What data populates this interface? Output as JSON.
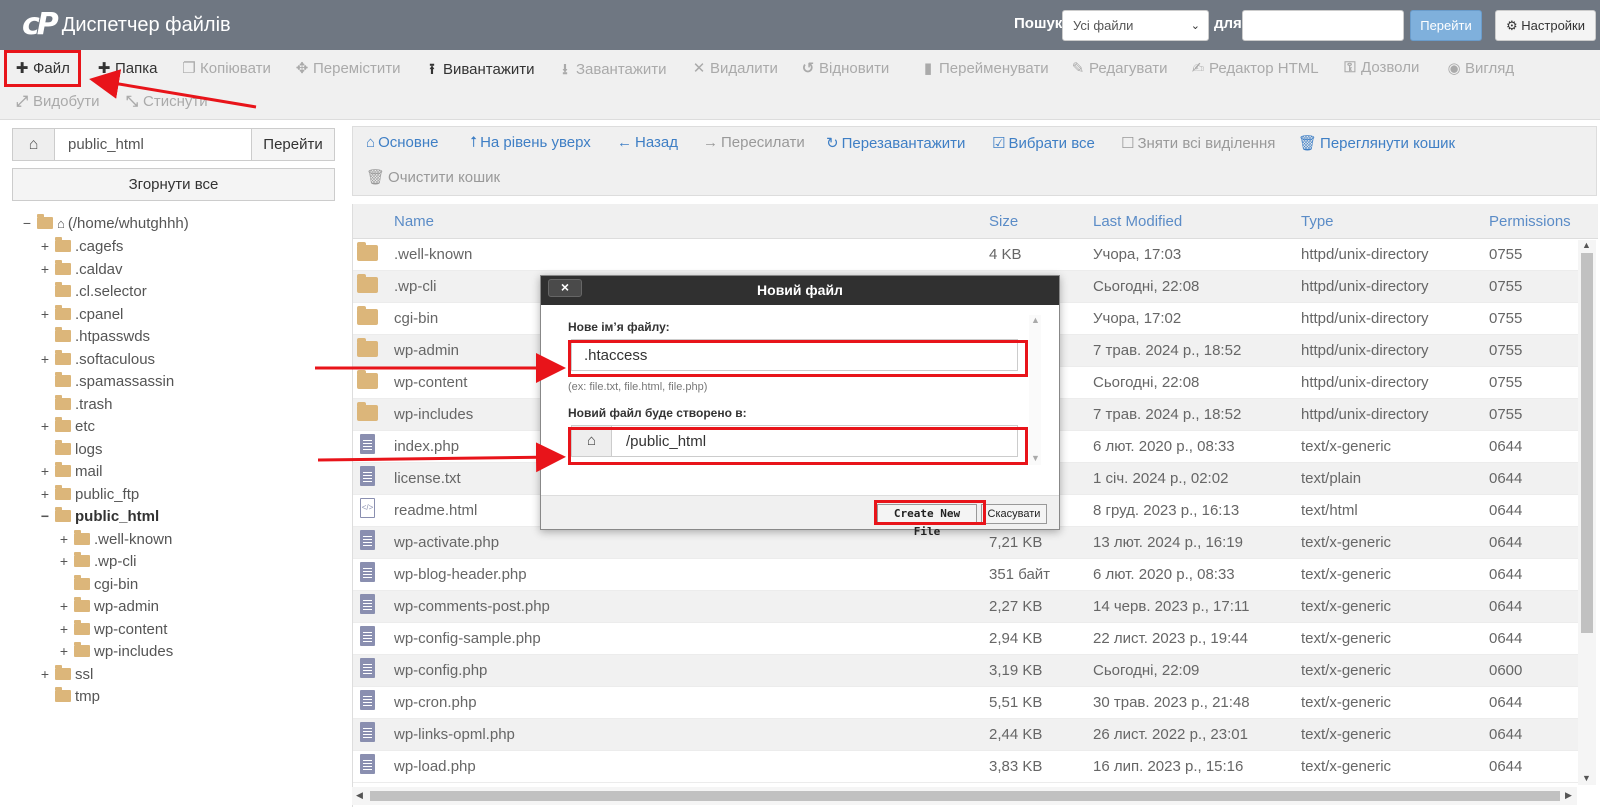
{
  "header": {
    "logo_mark": "cP",
    "title": "Диспетчер файлів",
    "search_label": "Пошук",
    "search_scope": "Усі файли",
    "for_label": "для",
    "search_value": "",
    "go_label": "Перейти",
    "settings_label": "Настройки"
  },
  "toolbar": {
    "items": [
      {
        "label": "Файл",
        "icon": "plus-icon",
        "enabled": true
      },
      {
        "label": "Папка",
        "icon": "plus-icon",
        "enabled": true
      },
      {
        "label": "Копіювати",
        "icon": "copy-icon",
        "enabled": false
      },
      {
        "label": "Перемістити",
        "icon": "move-icon",
        "enabled": false
      },
      {
        "label": "Вивантажити",
        "icon": "upload-icon",
        "enabled": true
      },
      {
        "label": "Завантажити",
        "icon": "download-icon",
        "enabled": false
      },
      {
        "label": "Видалити",
        "icon": "delete-icon",
        "enabled": false
      },
      {
        "label": "Відновити",
        "icon": "restore-icon",
        "enabled": false
      },
      {
        "label": "Перейменувати",
        "icon": "file-icon",
        "enabled": false
      },
      {
        "label": "Редагувати",
        "icon": "pencil-icon",
        "enabled": false
      },
      {
        "label": "Редактор HTML",
        "icon": "edit-icon",
        "enabled": false
      },
      {
        "label": "Дозволи",
        "icon": "key-icon",
        "enabled": false
      },
      {
        "label": "Вигляд",
        "icon": "eye-icon",
        "enabled": false
      },
      {
        "label": "Видобути",
        "icon": "expand-icon",
        "enabled": false
      },
      {
        "label": "Стиснути",
        "icon": "compress-icon",
        "enabled": false
      }
    ]
  },
  "left_pane": {
    "path_value": "public_html",
    "go_label": "Перейти",
    "collapse_label": "Згорнути все",
    "tree": [
      {
        "label": "(/home/whutghhh)",
        "toggle": "−",
        "home": true
      },
      {
        "label": ".cagefs",
        "toggle": "+"
      },
      {
        "label": ".caldav",
        "toggle": "+"
      },
      {
        "label": ".cl.selector",
        "toggle": ""
      },
      {
        "label": ".cpanel",
        "toggle": "+"
      },
      {
        "label": ".htpasswds",
        "toggle": ""
      },
      {
        "label": ".softaculous",
        "toggle": "+"
      },
      {
        "label": ".spamassassin",
        "toggle": ""
      },
      {
        "label": ".trash",
        "toggle": ""
      },
      {
        "label": "etc",
        "toggle": "+"
      },
      {
        "label": "logs",
        "toggle": ""
      },
      {
        "label": "mail",
        "toggle": "+"
      },
      {
        "label": "public_ftp",
        "toggle": "+"
      },
      {
        "label": "public_html",
        "toggle": "−",
        "bold": true
      },
      {
        "label": ".well-known",
        "toggle": "+",
        "depth": 2
      },
      {
        "label": ".wp-cli",
        "toggle": "+",
        "depth": 2
      },
      {
        "label": "cgi-bin",
        "toggle": "",
        "depth": 2
      },
      {
        "label": "wp-admin",
        "toggle": "+",
        "depth": 2
      },
      {
        "label": "wp-content",
        "toggle": "+",
        "depth": 2
      },
      {
        "label": "wp-includes",
        "toggle": "+",
        "depth": 2
      },
      {
        "label": "ssl",
        "toggle": "+"
      },
      {
        "label": "tmp",
        "toggle": ""
      }
    ]
  },
  "nav": {
    "home": "Основне",
    "up": "На рівень уверх",
    "back": "Назад",
    "forward": "Пересилати",
    "reload": "Перезавантажити",
    "select_all": "Вибрати все",
    "unselect_all": "Зняти всі виділення",
    "view_trash": "Переглянути кошик",
    "empty_trash": "Очистити кошик"
  },
  "table": {
    "columns": {
      "name": "Name",
      "size": "Size",
      "modified": "Last Modified",
      "type": "Type",
      "perms": "Permissions"
    },
    "rows": [
      {
        "icon": "folder",
        "name": ".well-known",
        "size": "4 KB",
        "modified": "Учора, 17:03",
        "type": "httpd/unix-directory",
        "perms": "0755"
      },
      {
        "icon": "folder",
        "name": ".wp-cli",
        "size": "",
        "modified": "Сьогодні, 22:08",
        "type": "httpd/unix-directory",
        "perms": "0755"
      },
      {
        "icon": "folder",
        "name": "cgi-bin",
        "size": "",
        "modified": "Учора, 17:02",
        "type": "httpd/unix-directory",
        "perms": "0755"
      },
      {
        "icon": "folder",
        "name": "wp-admin",
        "size": "",
        "modified": "7 трав. 2024 р., 18:52",
        "type": "httpd/unix-directory",
        "perms": "0755"
      },
      {
        "icon": "folder",
        "name": "wp-content",
        "size": "",
        "modified": "Сьогодні, 22:08",
        "type": "httpd/unix-directory",
        "perms": "0755"
      },
      {
        "icon": "folder",
        "name": "wp-includes",
        "size": "",
        "modified": "7 трав. 2024 р., 18:52",
        "type": "httpd/unix-directory",
        "perms": "0755"
      },
      {
        "icon": "doc",
        "name": "index.php",
        "size": "",
        "modified": "6 лют. 2020 р., 08:33",
        "type": "text/x-generic",
        "perms": "0644"
      },
      {
        "icon": "doc",
        "name": "license.txt",
        "size": "",
        "modified": "1 січ. 2024 р., 02:02",
        "type": "text/plain",
        "perms": "0644"
      },
      {
        "icon": "html",
        "name": "readme.html",
        "size": "",
        "modified": "8 груд. 2023 р., 16:13",
        "type": "text/html",
        "perms": "0644"
      },
      {
        "icon": "doc",
        "name": "wp-activate.php",
        "size": "7,21 KB",
        "modified": "13 лют. 2024 р., 16:19",
        "type": "text/x-generic",
        "perms": "0644"
      },
      {
        "icon": "doc",
        "name": "wp-blog-header.php",
        "size": "351 байт",
        "modified": "6 лют. 2020 р., 08:33",
        "type": "text/x-generic",
        "perms": "0644"
      },
      {
        "icon": "doc",
        "name": "wp-comments-post.php",
        "size": "2,27 KB",
        "modified": "14 черв. 2023 р., 17:11",
        "type": "text/x-generic",
        "perms": "0644"
      },
      {
        "icon": "doc",
        "name": "wp-config-sample.php",
        "size": "2,94 KB",
        "modified": "22 лист. 2023 р., 19:44",
        "type": "text/x-generic",
        "perms": "0644"
      },
      {
        "icon": "doc",
        "name": "wp-config.php",
        "size": "3,19 KB",
        "modified": "Сьогодні, 22:09",
        "type": "text/x-generic",
        "perms": "0600"
      },
      {
        "icon": "doc",
        "name": "wp-cron.php",
        "size": "5,51 KB",
        "modified": "30 трав. 2023 р., 21:48",
        "type": "text/x-generic",
        "perms": "0644"
      },
      {
        "icon": "doc",
        "name": "wp-links-opml.php",
        "size": "2,44 KB",
        "modified": "26 лист. 2022 р., 23:01",
        "type": "text/x-generic",
        "perms": "0644"
      },
      {
        "icon": "doc",
        "name": "wp-load.php",
        "size": "3,83 KB",
        "modified": "16 лип. 2023 р., 15:16",
        "type": "text/x-generic",
        "perms": "0644"
      }
    ]
  },
  "modal": {
    "close": "×",
    "title": "Новий файл",
    "name_label": "Нове ім’я файлу:",
    "name_value": ".htaccess",
    "hint": "(ex: file.txt, file.html, file.php)",
    "location_label": "Новий файл буде створено в:",
    "location_value": "/public_html",
    "create_label": "Create New File",
    "cancel_label": "Скасувати"
  },
  "colors": {
    "header_bg": "#6f7782",
    "link_blue": "#3f7fc5",
    "annotation_red": "#e8141a",
    "folder": "#dcb67a"
  }
}
